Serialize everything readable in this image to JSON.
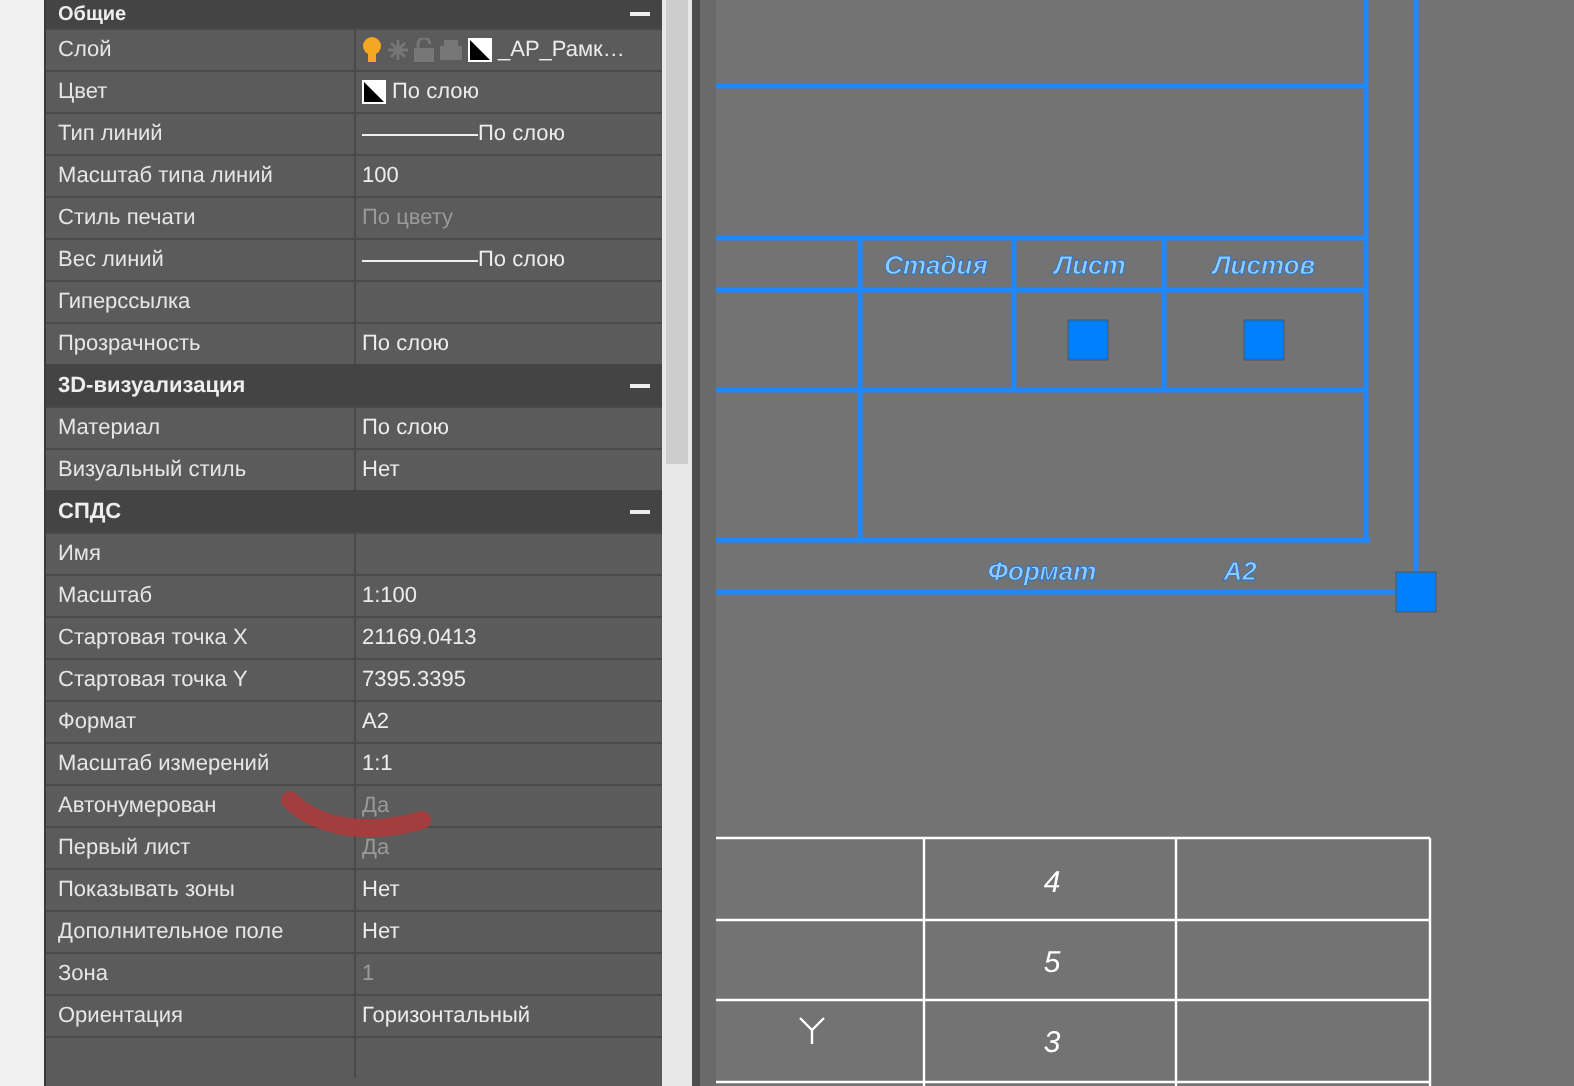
{
  "properties": {
    "sections": [
      {
        "title": "Общие",
        "expanded": true,
        "rows": [
          {
            "label": "Слой",
            "value": "_АР_Рамк…",
            "kind": "layer"
          },
          {
            "label": "Цвет",
            "value": "По слою",
            "kind": "color"
          },
          {
            "label": "Тип линий",
            "value": "По слою",
            "kind": "linetype"
          },
          {
            "label": "Масштаб типа линий",
            "value": "100",
            "kind": "text"
          },
          {
            "label": "Стиль печати",
            "value": "По цвету",
            "kind": "greyed"
          },
          {
            "label": "Вес линий",
            "value": "По слою",
            "kind": "linetype"
          },
          {
            "label": "Гиперссылка",
            "value": "",
            "kind": "text"
          },
          {
            "label": "Прозрачность",
            "value": "По слою",
            "kind": "text"
          }
        ]
      },
      {
        "title": "3D-визуализация",
        "expanded": true,
        "rows": [
          {
            "label": "Материал",
            "value": "По слою",
            "kind": "text"
          },
          {
            "label": "Визуальный стиль",
            "value": "Нет",
            "kind": "text"
          }
        ]
      },
      {
        "title": "СПДС",
        "expanded": true,
        "rows": [
          {
            "label": "Имя",
            "value": "",
            "kind": "text"
          },
          {
            "label": "Масштаб",
            "value": "1:100",
            "kind": "text"
          },
          {
            "label": "Стартовая точка X",
            "value": "21169.0413",
            "kind": "text"
          },
          {
            "label": "Стартовая точка Y",
            "value": "7395.3395",
            "kind": "text"
          },
          {
            "label": "Формат",
            "value": "A2",
            "kind": "text"
          },
          {
            "label": "Масштаб измерений",
            "value": "1:1",
            "kind": "text"
          },
          {
            "label": "Автонумерован",
            "value": "Да",
            "kind": "greyed"
          },
          {
            "label": "Первый лист",
            "value": "Да",
            "kind": "greyed"
          },
          {
            "label": "Показывать зоны",
            "value": "Нет",
            "kind": "text"
          },
          {
            "label": "Дополнительное поле",
            "value": "Нет",
            "kind": "text"
          },
          {
            "label": "Зона",
            "value": "1",
            "kind": "greyed"
          },
          {
            "label": "Ориентация",
            "value": "Горизонтальный",
            "kind": "text"
          }
        ]
      }
    ]
  },
  "drawing": {
    "title_block": [
      "Стадия",
      "Лист",
      "Листов"
    ],
    "format_label": "Формат",
    "format_value": "A2",
    "table_cells": [
      "4",
      "5",
      "3"
    ]
  }
}
